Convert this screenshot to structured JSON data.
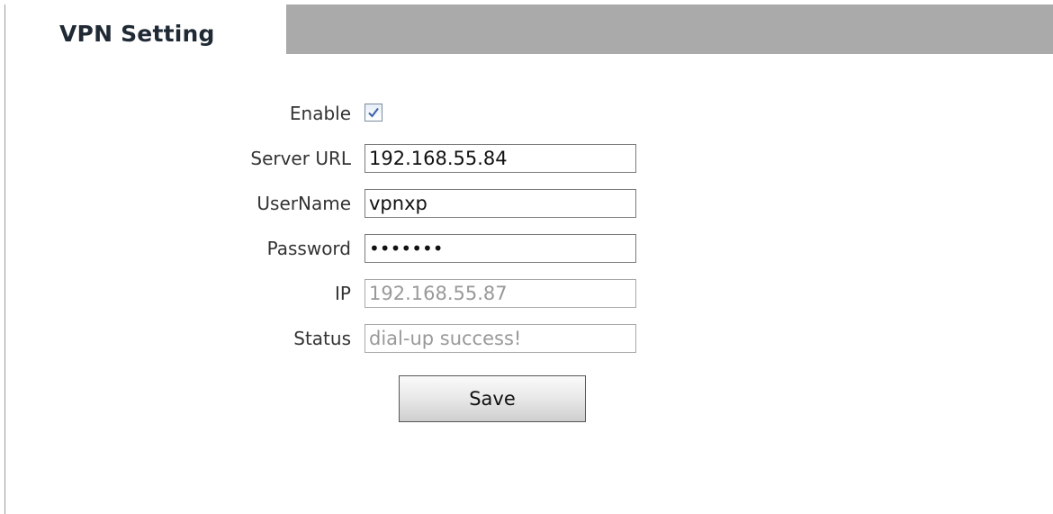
{
  "tab": {
    "title": "VPN Setting"
  },
  "form": {
    "enable": {
      "label": "Enable",
      "checked": true
    },
    "server_url": {
      "label": "Server URL",
      "value": "192.168.55.84"
    },
    "username": {
      "label": "UserName",
      "value": "vpnxp"
    },
    "password": {
      "label": "Password",
      "value": "1234567"
    },
    "ip": {
      "label": "IP",
      "value": "192.168.55.87"
    },
    "status": {
      "label": "Status",
      "value": "dial-up success!"
    }
  },
  "actions": {
    "save_label": "Save"
  },
  "colors": {
    "header_bar": "#aaaaaa",
    "disabled_text": "#999999",
    "check_mark": "#3a5fa8"
  },
  "icons": {
    "enable_checkbox": "check-mark-icon"
  }
}
